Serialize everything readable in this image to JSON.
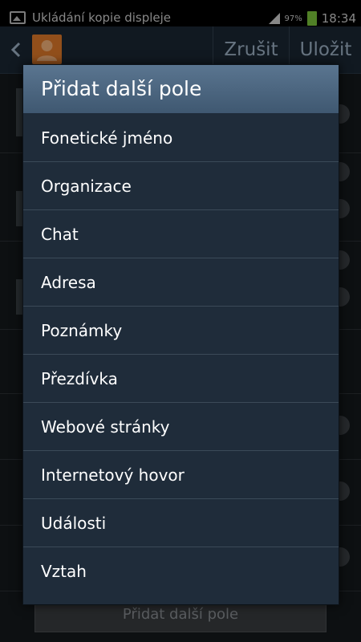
{
  "status_bar": {
    "notification_text": "Ukládání kopie displeje",
    "battery_percent": "97%",
    "clock": "18:34"
  },
  "action_bar": {
    "cancel_label": "Zrušit",
    "save_label": "Uložit"
  },
  "background_form": {
    "add_field_label": "Přidat další pole"
  },
  "dialog": {
    "title": "Přidat další pole",
    "items": [
      {
        "label": "Fonetické jméno"
      },
      {
        "label": "Organizace"
      },
      {
        "label": "Chat"
      },
      {
        "label": "Adresa"
      },
      {
        "label": "Poznámky"
      },
      {
        "label": "Přezdívka"
      },
      {
        "label": "Webové stránky"
      },
      {
        "label": "Internetový hovor"
      },
      {
        "label": "Události"
      },
      {
        "label": "Vztah"
      }
    ]
  }
}
